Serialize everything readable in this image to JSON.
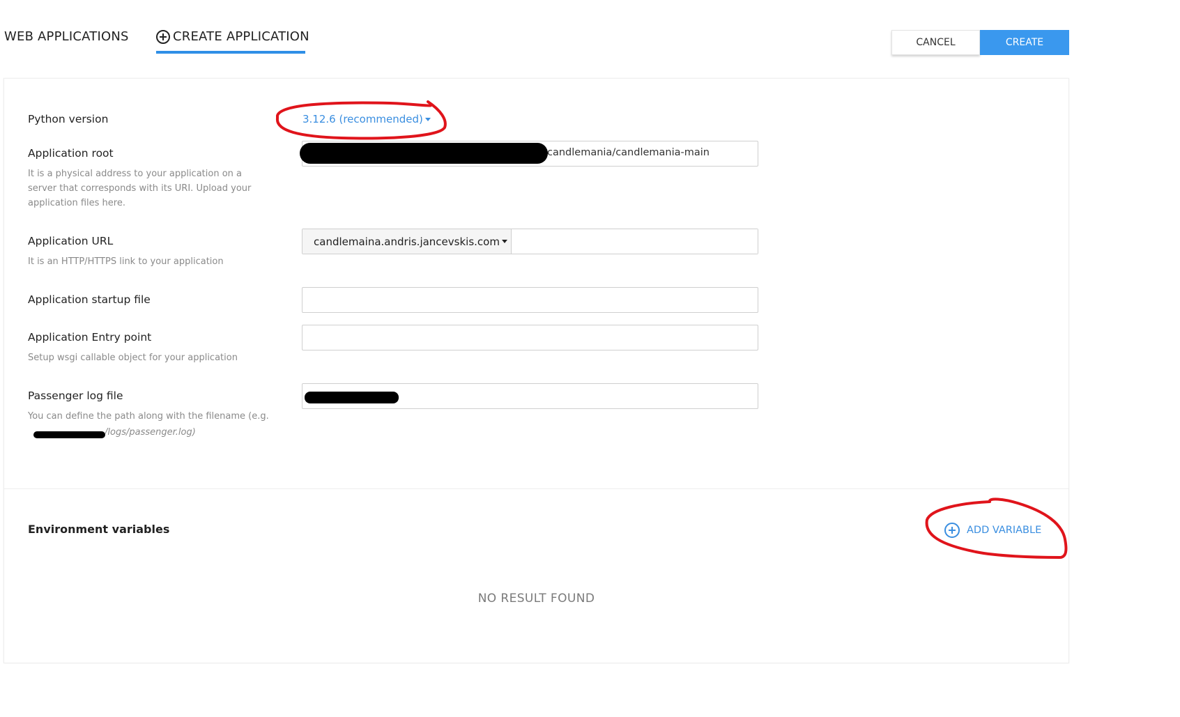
{
  "tabs": {
    "web_applications": "WEB APPLICATIONS",
    "create_application": "CREATE APPLICATION"
  },
  "actions": {
    "cancel": "CANCEL",
    "create": "CREATE"
  },
  "form": {
    "python_version": {
      "label": "Python version",
      "value": "3.12.6 (recommended)"
    },
    "application_root": {
      "label": "Application root",
      "hint": "It is a physical address to your application on a server that corresponds with its URI. Upload your application files here.",
      "value_visible": "candlemania/candlemania-main"
    },
    "application_url": {
      "label": "Application URL",
      "hint": "It is an HTTP/HTTPS link to your application",
      "domain": "candlemaina.andris.jancevskis.com",
      "path": ""
    },
    "startup_file": {
      "label": "Application startup file",
      "value": ""
    },
    "entry_point": {
      "label": "Application Entry point",
      "hint": "Setup wsgi callable object for your application",
      "value": ""
    },
    "passenger_log": {
      "label": "Passenger log file",
      "hint": "You can define the path along with the filename (e.g.",
      "hint_example": "/logs/passenger.log)"
    }
  },
  "env": {
    "title": "Environment variables",
    "add_label": "ADD VARIABLE",
    "empty_text": "NO RESULT FOUND"
  },
  "colors": {
    "accent": "#3a98ee",
    "link": "#3a8ee0",
    "annotation": "#e0141b"
  }
}
